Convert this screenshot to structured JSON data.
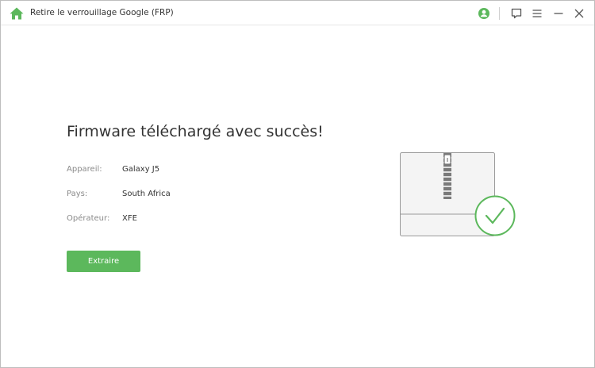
{
  "window": {
    "title": "Retire le verrouillage Google (FRP)"
  },
  "titlebar_icons": [
    "home-icon",
    "account-icon",
    "feedback-icon",
    "menu-icon",
    "minimize-icon",
    "close-icon"
  ],
  "colors": {
    "accent_green": "#5cb85c",
    "text_dark": "#333333",
    "text_muted": "#8a8a8a"
  },
  "main": {
    "headline": "Firmware téléchargé avec succès!",
    "info": [
      {
        "label": "Appareil:",
        "value": "Galaxy J5"
      },
      {
        "label": "Pays:",
        "value": "South Africa"
      },
      {
        "label": "Opérateur:",
        "value": "XFE"
      }
    ],
    "extract_button": "Extraire"
  },
  "illustration": {
    "icons": [
      "zip-archive-icon",
      "success-check-icon"
    ]
  }
}
